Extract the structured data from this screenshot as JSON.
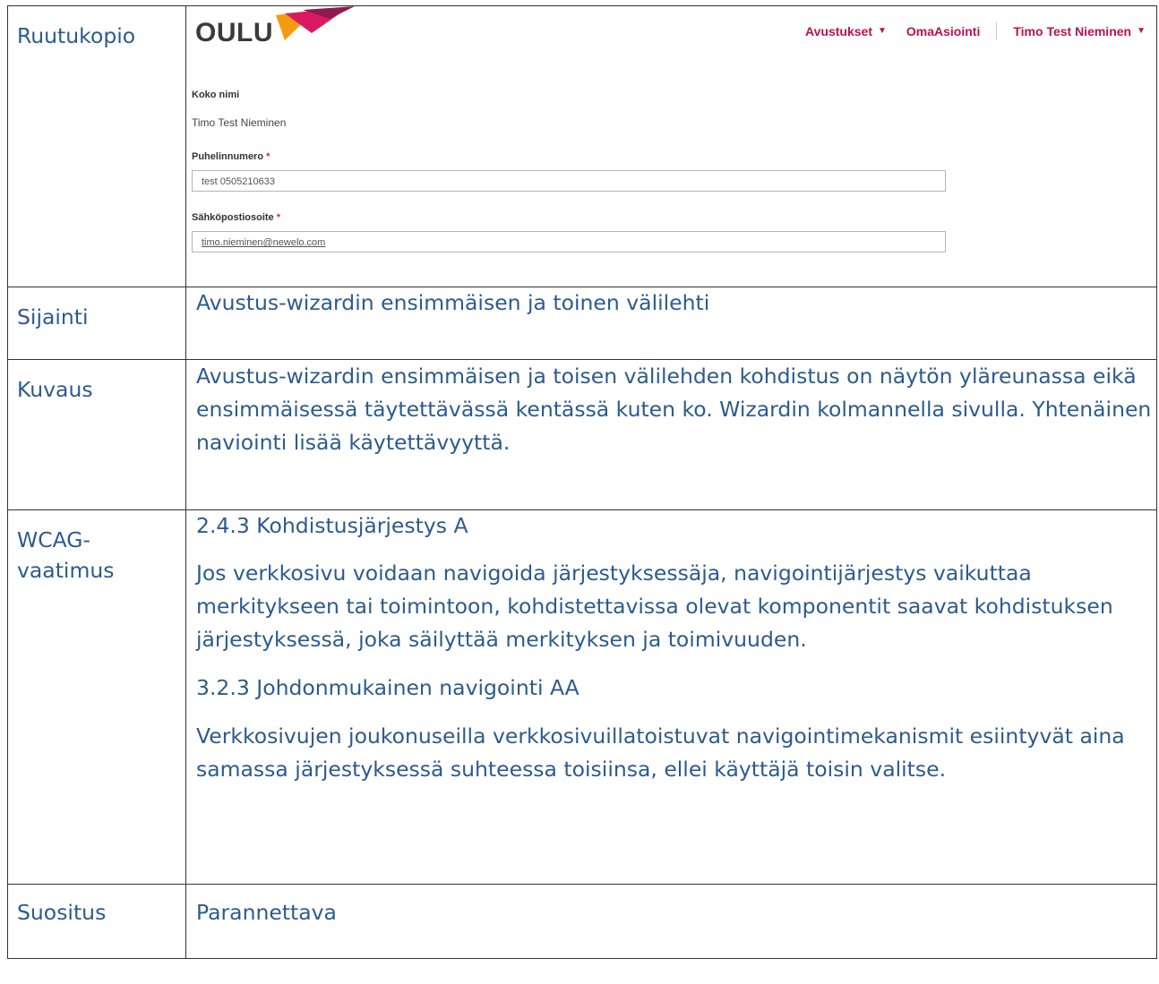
{
  "rows": {
    "screenshot": {
      "label": "Ruutukopio",
      "logo_text": "OULU",
      "nav": {
        "grants": "Avustukset",
        "own_services": "OmaAsiointi",
        "user": "Timo Test Nieminen"
      },
      "form": {
        "fullname_label": "Koko nimi",
        "fullname_value": "Timo Test Nieminen",
        "phone_label": "Puhelinnumero",
        "phone_value": "test 0505210633",
        "email_label": "Sähköpostiosoite",
        "email_value": "timo.nieminen@newelo.com",
        "required_mark": "*"
      }
    },
    "location": {
      "label": "Sijainti",
      "text": "Avustus-wizardin ensimmäisen ja toinen välilehti"
    },
    "description": {
      "label": "Kuvaus",
      "text": "Avustus-wizardin ensimmäisen ja toisen välilehden kohdistus on näytön yläreunassa eikä ensimmäisessä täytettävässä kentässä kuten ko. Wizardin kolmannella sivulla. Yhtenäinen naviointi lisää käytettävyyttä."
    },
    "wcag": {
      "label": "WCAG-vaatimus",
      "req1_title": "2.4.3 Kohdistusjärjestys A",
      "req1_text": "Jos verkkosivu voidaan navigoida järjestyksessäja, navigointijärjestys vaikuttaa merkitykseen tai toimintoon, kohdistettavissa olevat komponentit saavat kohdistuksen järjestyksessä, joka säilyttää merkityksen ja toimivuuden.",
      "req2_title": "3.2.3 Johdonmukainen navigointi AA",
      "req2_text": "Verkkosivujen joukonuseilla verkkosivuillatoistuvat navigointimekanismit esiintyvät aina samassa järjestyksessä suhteessa toisiinsa, ellei käyttäjä toisin valitse."
    },
    "recommendation": {
      "label": "Suositus",
      "text": "Parannettava"
    }
  },
  "colors": {
    "text_blue": "#2c5b8e",
    "nav_red": "#b8124f",
    "recommendation_purple": "#6a2d8f"
  }
}
